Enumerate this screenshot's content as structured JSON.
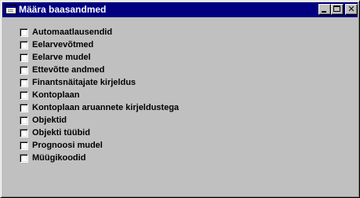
{
  "window": {
    "title": "Määra baasandmed",
    "close_glyph": "✕"
  },
  "checklist": {
    "items": [
      {
        "label": "Automaatlausendid",
        "checked": false
      },
      {
        "label": "Eelarvevõtmed",
        "checked": false
      },
      {
        "label": "Eelarve mudel",
        "checked": false
      },
      {
        "label": "Ettevõtte andmed",
        "checked": false
      },
      {
        "label": "Finantsnäitajate kirjeldus",
        "checked": false
      },
      {
        "label": "Kontoplaan",
        "checked": false
      },
      {
        "label": "Kontoplaan aruannete kirjeldustega",
        "checked": false
      },
      {
        "label": "Objektid",
        "checked": false
      },
      {
        "label": "Objekti tüübid",
        "checked": false
      },
      {
        "label": "Prognoosi mudel",
        "checked": false
      },
      {
        "label": "Müügikoodid",
        "checked": false
      }
    ]
  }
}
